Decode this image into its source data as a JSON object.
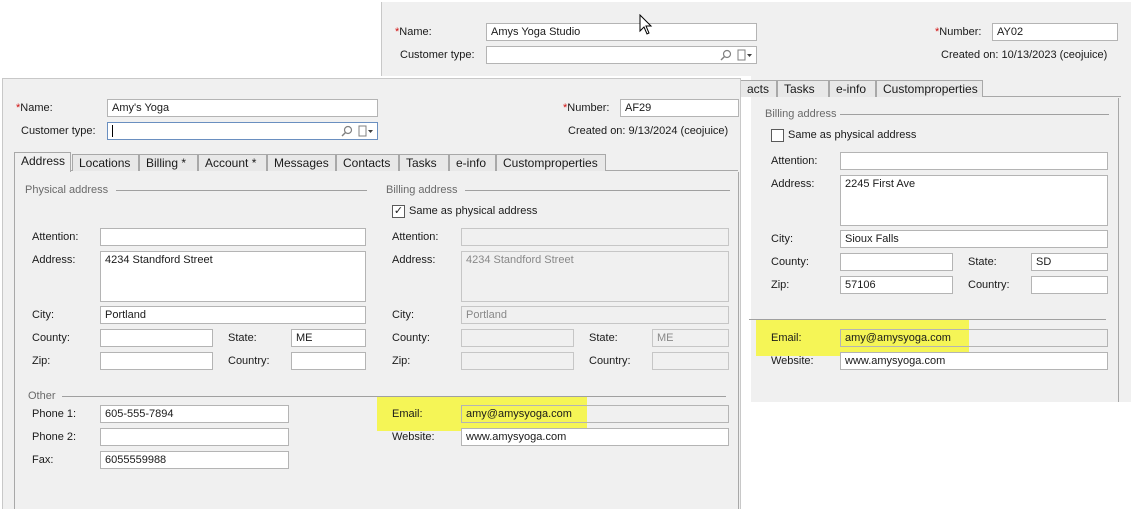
{
  "back_window": {
    "name_label": "Name:",
    "name_value": "Amys Yoga Studio",
    "number_label": "Number:",
    "number_value": "AY02",
    "customer_type_label": "Customer type:",
    "customer_type_value": "",
    "created_on": "Created on: 10/13/2023 (ceojuice)",
    "tabs": [
      "acts",
      "Tasks",
      "e-info",
      "Customproperties"
    ],
    "billing": {
      "section_title": "Billing address",
      "same_as_label": "Same as physical address",
      "same_as_checked": false,
      "attention_label": "Attention:",
      "attention_value": "",
      "address_label": "Address:",
      "address_value": "2245 First Ave",
      "city_label": "City:",
      "city_value": "Sioux Falls",
      "county_label": "County:",
      "county_value": "",
      "state_label": "State:",
      "state_value": "SD",
      "zip_label": "Zip:",
      "zip_value": "57106",
      "country_label": "Country:",
      "country_value": ""
    },
    "email_label": "Email:",
    "email_value": "amy@amysyoga.com",
    "website_label": "Website:",
    "website_value": "www.amysyoga.com"
  },
  "front_window": {
    "name_label": "Name:",
    "name_value": "Amy's Yoga",
    "number_label": "Number:",
    "number_value": "AF29",
    "customer_type_label": "Customer type:",
    "customer_type_value": "",
    "created_on": "Created on: 9/13/2024 (ceojuice)",
    "tabs": [
      "Address",
      "Locations",
      "Billing *",
      "Account *",
      "Messages",
      "Contacts",
      "Tasks",
      "e-info",
      "Customproperties"
    ],
    "physical": {
      "section_title": "Physical address",
      "attention_label": "Attention:",
      "attention_value": "",
      "address_label": "Address:",
      "address_value": "4234 Standford Street",
      "city_label": "City:",
      "city_value": "Portland",
      "county_label": "County:",
      "county_value": "",
      "state_label": "State:",
      "state_value": "ME",
      "zip_label": "Zip:",
      "zip_value": "",
      "country_label": "Country:",
      "country_value": ""
    },
    "billing": {
      "section_title": "Billing address",
      "same_as_label": "Same as physical address",
      "same_as_checked": true,
      "attention_label": "Attention:",
      "attention_value": "",
      "address_label": "Address:",
      "address_value": "4234 Standford Street",
      "city_label": "City:",
      "city_value": "Portland",
      "county_label": "County:",
      "county_value": "",
      "state_label": "State:",
      "state_value": "ME",
      "zip_label": "Zip:",
      "zip_value": "",
      "country_label": "Country:",
      "country_value": ""
    },
    "other": {
      "section_title": "Other",
      "phone1_label": "Phone 1:",
      "phone1_value": "605-555-7894",
      "phone2_label": "Phone 2:",
      "phone2_value": "",
      "fax_label": "Fax:",
      "fax_value": "6055559988",
      "email_label": "Email:",
      "email_value": "amy@amysyoga.com",
      "website_label": "Website:",
      "website_value": "www.amysyoga.com"
    }
  },
  "icons": {
    "search": "magnifier-icon",
    "dropdown": "dropdown-icon",
    "checkmark": "✓"
  },
  "colors": {
    "highlight": "#f5f556",
    "required": "#d01010"
  }
}
